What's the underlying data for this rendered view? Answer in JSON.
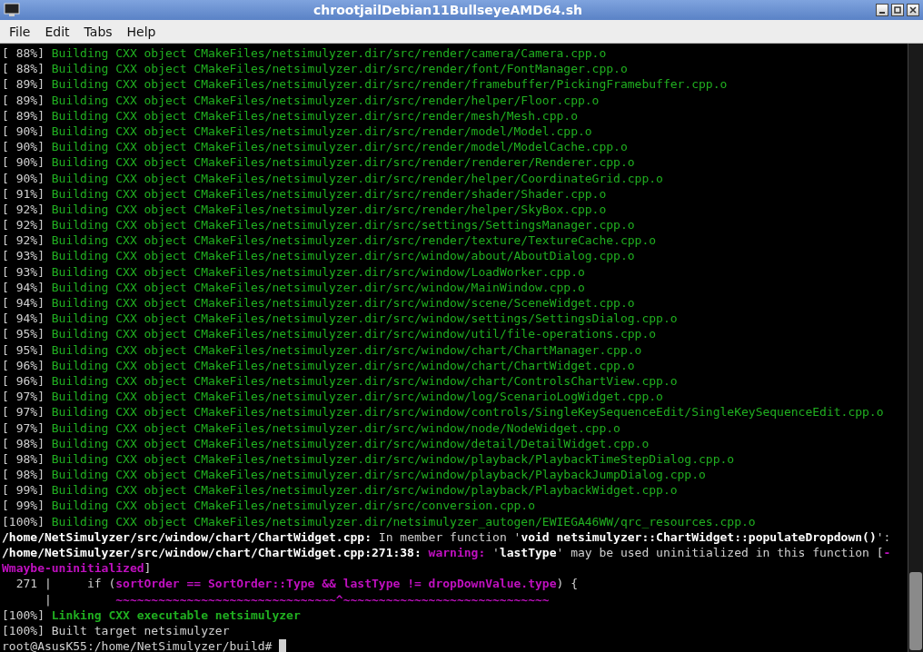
{
  "window": {
    "title": "chrootjailDebian11BullseyeAMD64.sh"
  },
  "menu": [
    "File",
    "Edit",
    "Tabs",
    "Help"
  ],
  "terminal": {
    "lines": [
      [
        {
          "t": "[ 88%] ",
          "kind": "plain"
        },
        {
          "t": "Building CXX object CMakeFiles/netsimulyzer.dir/src/render/camera/Camera.cpp.o",
          "kind": "green"
        }
      ],
      [
        {
          "t": "[ 88%] ",
          "kind": "plain"
        },
        {
          "t": "Building CXX object CMakeFiles/netsimulyzer.dir/src/render/font/FontManager.cpp.o",
          "kind": "green"
        }
      ],
      [
        {
          "t": "[ 89%] ",
          "kind": "plain"
        },
        {
          "t": "Building CXX object CMakeFiles/netsimulyzer.dir/src/render/framebuffer/PickingFramebuffer.cpp.o",
          "kind": "green"
        }
      ],
      [
        {
          "t": "[ 89%] ",
          "kind": "plain"
        },
        {
          "t": "Building CXX object CMakeFiles/netsimulyzer.dir/src/render/helper/Floor.cpp.o",
          "kind": "green"
        }
      ],
      [
        {
          "t": "[ 89%] ",
          "kind": "plain"
        },
        {
          "t": "Building CXX object CMakeFiles/netsimulyzer.dir/src/render/mesh/Mesh.cpp.o",
          "kind": "green"
        }
      ],
      [
        {
          "t": "[ 90%] ",
          "kind": "plain"
        },
        {
          "t": "Building CXX object CMakeFiles/netsimulyzer.dir/src/render/model/Model.cpp.o",
          "kind": "green"
        }
      ],
      [
        {
          "t": "[ 90%] ",
          "kind": "plain"
        },
        {
          "t": "Building CXX object CMakeFiles/netsimulyzer.dir/src/render/model/ModelCache.cpp.o",
          "kind": "green"
        }
      ],
      [
        {
          "t": "[ 90%] ",
          "kind": "plain"
        },
        {
          "t": "Building CXX object CMakeFiles/netsimulyzer.dir/src/render/renderer/Renderer.cpp.o",
          "kind": "green"
        }
      ],
      [
        {
          "t": "[ 90%] ",
          "kind": "plain"
        },
        {
          "t": "Building CXX object CMakeFiles/netsimulyzer.dir/src/render/helper/CoordinateGrid.cpp.o",
          "kind": "green"
        }
      ],
      [
        {
          "t": "[ 91%] ",
          "kind": "plain"
        },
        {
          "t": "Building CXX object CMakeFiles/netsimulyzer.dir/src/render/shader/Shader.cpp.o",
          "kind": "green"
        }
      ],
      [
        {
          "t": "[ 92%] ",
          "kind": "plain"
        },
        {
          "t": "Building CXX object CMakeFiles/netsimulyzer.dir/src/render/helper/SkyBox.cpp.o",
          "kind": "green"
        }
      ],
      [
        {
          "t": "[ 92%] ",
          "kind": "plain"
        },
        {
          "t": "Building CXX object CMakeFiles/netsimulyzer.dir/src/settings/SettingsManager.cpp.o",
          "kind": "green"
        }
      ],
      [
        {
          "t": "[ 92%] ",
          "kind": "plain"
        },
        {
          "t": "Building CXX object CMakeFiles/netsimulyzer.dir/src/render/texture/TextureCache.cpp.o",
          "kind": "green"
        }
      ],
      [
        {
          "t": "[ 93%] ",
          "kind": "plain"
        },
        {
          "t": "Building CXX object CMakeFiles/netsimulyzer.dir/src/window/about/AboutDialog.cpp.o",
          "kind": "green"
        }
      ],
      [
        {
          "t": "[ 93%] ",
          "kind": "plain"
        },
        {
          "t": "Building CXX object CMakeFiles/netsimulyzer.dir/src/window/LoadWorker.cpp.o",
          "kind": "green"
        }
      ],
      [
        {
          "t": "[ 94%] ",
          "kind": "plain"
        },
        {
          "t": "Building CXX object CMakeFiles/netsimulyzer.dir/src/window/MainWindow.cpp.o",
          "kind": "green"
        }
      ],
      [
        {
          "t": "[ 94%] ",
          "kind": "plain"
        },
        {
          "t": "Building CXX object CMakeFiles/netsimulyzer.dir/src/window/scene/SceneWidget.cpp.o",
          "kind": "green"
        }
      ],
      [
        {
          "t": "[ 94%] ",
          "kind": "plain"
        },
        {
          "t": "Building CXX object CMakeFiles/netsimulyzer.dir/src/window/settings/SettingsDialog.cpp.o",
          "kind": "green"
        }
      ],
      [
        {
          "t": "[ 95%] ",
          "kind": "plain"
        },
        {
          "t": "Building CXX object CMakeFiles/netsimulyzer.dir/src/window/util/file-operations.cpp.o",
          "kind": "green"
        }
      ],
      [
        {
          "t": "[ 95%] ",
          "kind": "plain"
        },
        {
          "t": "Building CXX object CMakeFiles/netsimulyzer.dir/src/window/chart/ChartManager.cpp.o",
          "kind": "green"
        }
      ],
      [
        {
          "t": "[ 96%] ",
          "kind": "plain"
        },
        {
          "t": "Building CXX object CMakeFiles/netsimulyzer.dir/src/window/chart/ChartWidget.cpp.o",
          "kind": "green"
        }
      ],
      [
        {
          "t": "[ 96%] ",
          "kind": "plain"
        },
        {
          "t": "Building CXX object CMakeFiles/netsimulyzer.dir/src/window/chart/ControlsChartView.cpp.o",
          "kind": "green"
        }
      ],
      [
        {
          "t": "[ 97%] ",
          "kind": "plain"
        },
        {
          "t": "Building CXX object CMakeFiles/netsimulyzer.dir/src/window/log/ScenarioLogWidget.cpp.o",
          "kind": "green"
        }
      ],
      [
        {
          "t": "[ 97%] ",
          "kind": "plain"
        },
        {
          "t": "Building CXX object CMakeFiles/netsimulyzer.dir/src/window/controls/SingleKeySequenceEdit/SingleKeySequenceEdit.cpp.o",
          "kind": "green"
        }
      ],
      [
        {
          "t": "[ 97%] ",
          "kind": "plain"
        },
        {
          "t": "Building CXX object CMakeFiles/netsimulyzer.dir/src/window/node/NodeWidget.cpp.o",
          "kind": "green"
        }
      ],
      [
        {
          "t": "[ 98%] ",
          "kind": "plain"
        },
        {
          "t": "Building CXX object CMakeFiles/netsimulyzer.dir/src/window/detail/DetailWidget.cpp.o",
          "kind": "green"
        }
      ],
      [
        {
          "t": "[ 98%] ",
          "kind": "plain"
        },
        {
          "t": "Building CXX object CMakeFiles/netsimulyzer.dir/src/window/playback/PlaybackTimeStepDialog.cpp.o",
          "kind": "green"
        }
      ],
      [
        {
          "t": "[ 98%] ",
          "kind": "plain"
        },
        {
          "t": "Building CXX object CMakeFiles/netsimulyzer.dir/src/window/playback/PlaybackJumpDialog.cpp.o",
          "kind": "green"
        }
      ],
      [
        {
          "t": "[ 99%] ",
          "kind": "plain"
        },
        {
          "t": "Building CXX object CMakeFiles/netsimulyzer.dir/src/window/playback/PlaybackWidget.cpp.o",
          "kind": "green"
        }
      ],
      [
        {
          "t": "[ 99%] ",
          "kind": "plain"
        },
        {
          "t": "Building CXX object CMakeFiles/netsimulyzer.dir/src/conversion.cpp.o",
          "kind": "green"
        }
      ],
      [
        {
          "t": "[100%] ",
          "kind": "plain"
        },
        {
          "t": "Building CXX object CMakeFiles/netsimulyzer.dir/netsimulyzer_autogen/EWIEGA46WW/qrc_resources.cpp.o",
          "kind": "green"
        }
      ],
      [
        {
          "t": "/home/NetSimulyzer/src/window/chart/ChartWidget.cpp:",
          "kind": "bold"
        },
        {
          "t": " In member function '",
          "kind": "plain"
        },
        {
          "t": "void netsimulyzer::ChartWidget::populateDropdown()",
          "kind": "bold"
        },
        {
          "t": "':",
          "kind": "plain"
        }
      ],
      [
        {
          "t": "/home/NetSimulyzer/src/window/chart/ChartWidget.cpp:271:38: ",
          "kind": "bold"
        },
        {
          "t": "warning: ",
          "kind": "magenta"
        },
        {
          "t": "'",
          "kind": "plain"
        },
        {
          "t": "lastType",
          "kind": "bold"
        },
        {
          "t": "' may be used uninitialized in this function [",
          "kind": "plain"
        },
        {
          "t": "-",
          "kind": "magenta"
        }
      ],
      [
        {
          "t": "Wmaybe-uninitialized",
          "kind": "magenta"
        },
        {
          "t": "]",
          "kind": "plain"
        }
      ],
      [
        {
          "t": "  271 |     if (",
          "kind": "plain"
        },
        {
          "t": "sortOrder == SortOrder::Type && lastType != dropDownValue.type",
          "kind": "magenta"
        },
        {
          "t": ") {",
          "kind": "plain"
        }
      ],
      [
        {
          "t": "      |         ",
          "kind": "plain"
        },
        {
          "t": "~~~~~~~~~~~~~~~~~~~~~~~~~~~~~~~^~~~~~~~~~~~~~~~~~~~~~~~~~~~~~",
          "kind": "magenta"
        }
      ],
      [
        {
          "t": "[100%] ",
          "kind": "plain"
        },
        {
          "t": "Linking CXX executable netsimulyzer",
          "kind": "bold-green"
        }
      ],
      [
        {
          "t": "[100%] Built target netsimulyzer",
          "kind": "plain"
        }
      ]
    ],
    "prompt": "root@AsusK55:/home/NetSimulyzer/build# "
  }
}
